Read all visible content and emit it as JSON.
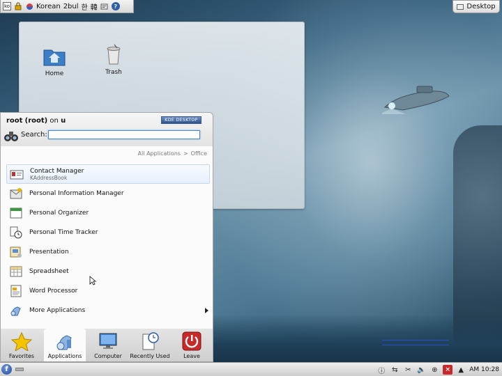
{
  "language_bar": {
    "input_method": "Korean",
    "layout": "2bul",
    "hangul_glyph": "한",
    "hanja_glyph": "韓",
    "icons": [
      "keyboard-toggle-icon",
      "lock-icon",
      "hangul-mode-icon",
      "settings-icon",
      "help-icon"
    ]
  },
  "desktop_button": {
    "label": "Desktop"
  },
  "desktop_icons": [
    {
      "label": "Home",
      "icon": "home-folder-icon"
    },
    {
      "label": "Trash",
      "icon": "trash-icon"
    }
  ],
  "kickoff": {
    "user": {
      "name": "root",
      "login": "(root)",
      "on_label": "on",
      "host": "u"
    },
    "badge": "KDE DESKTOP",
    "search": {
      "label": "Search:",
      "value": "",
      "placeholder": ""
    },
    "breadcrumb": {
      "root": "All Applications",
      "separator": ">",
      "current": "Office"
    },
    "items": [
      {
        "label": "Contact Manager",
        "sublabel": "KAddressBook",
        "icon": "address-book-icon",
        "selected": true
      },
      {
        "label": "Personal Information Manager",
        "icon": "kontact-icon"
      },
      {
        "label": "Personal Organizer",
        "icon": "calendar-icon"
      },
      {
        "label": "Personal Time Tracker",
        "icon": "clock-tracker-icon"
      },
      {
        "label": "Presentation",
        "icon": "presentation-icon"
      },
      {
        "label": "Spreadsheet",
        "icon": "spreadsheet-icon"
      },
      {
        "label": "Word Processor",
        "icon": "word-processor-icon"
      },
      {
        "label": "More Applications",
        "icon": "applications-icon",
        "has_submenu": true
      }
    ],
    "tabs": [
      {
        "label": "Favorites",
        "icon": "star-icon"
      },
      {
        "label": "Applications",
        "icon": "applications-icon",
        "active": true
      },
      {
        "label": "Computer",
        "icon": "monitor-icon"
      },
      {
        "label": "Recently Used",
        "icon": "document-clock-icon"
      },
      {
        "label": "Leave",
        "icon": "power-icon"
      }
    ]
  },
  "taskbar": {
    "clock": "AM 10:28",
    "tray_icons": [
      "info-icon",
      "network-icon",
      "scissors-icon",
      "volume-icon",
      "network-manager-icon",
      "close-icon"
    ]
  },
  "colors": {
    "accent": "#4b86c8",
    "leave_red": "#c62a2a",
    "kde_blue": "#2f518a"
  }
}
